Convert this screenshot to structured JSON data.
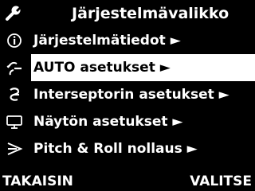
{
  "header": {
    "icon": "wrench-icon",
    "title": "Järjestelmävalikko"
  },
  "menu": {
    "items": [
      {
        "label": "Järjestelmätiedot ►",
        "icon": "info-icon",
        "selected": false
      },
      {
        "label": "AUTO asetukset ►",
        "icon": "steering-icon",
        "selected": true
      },
      {
        "label": "Interseptorin asetukset ►",
        "icon": "interceptor-icon",
        "selected": false
      },
      {
        "label": "Näytön asetukset ►",
        "icon": "monitor-icon",
        "selected": false
      },
      {
        "label": "Pitch & Roll nollaus ►",
        "icon": "pitch-roll-icon",
        "selected": false
      }
    ]
  },
  "footer": {
    "back_label": "TAKAISIN",
    "select_label": "VALITSE"
  },
  "colors": {
    "background": "#000000",
    "text": "#ffffff",
    "highlight": "#ffffff",
    "highlight_text": "#000000"
  }
}
